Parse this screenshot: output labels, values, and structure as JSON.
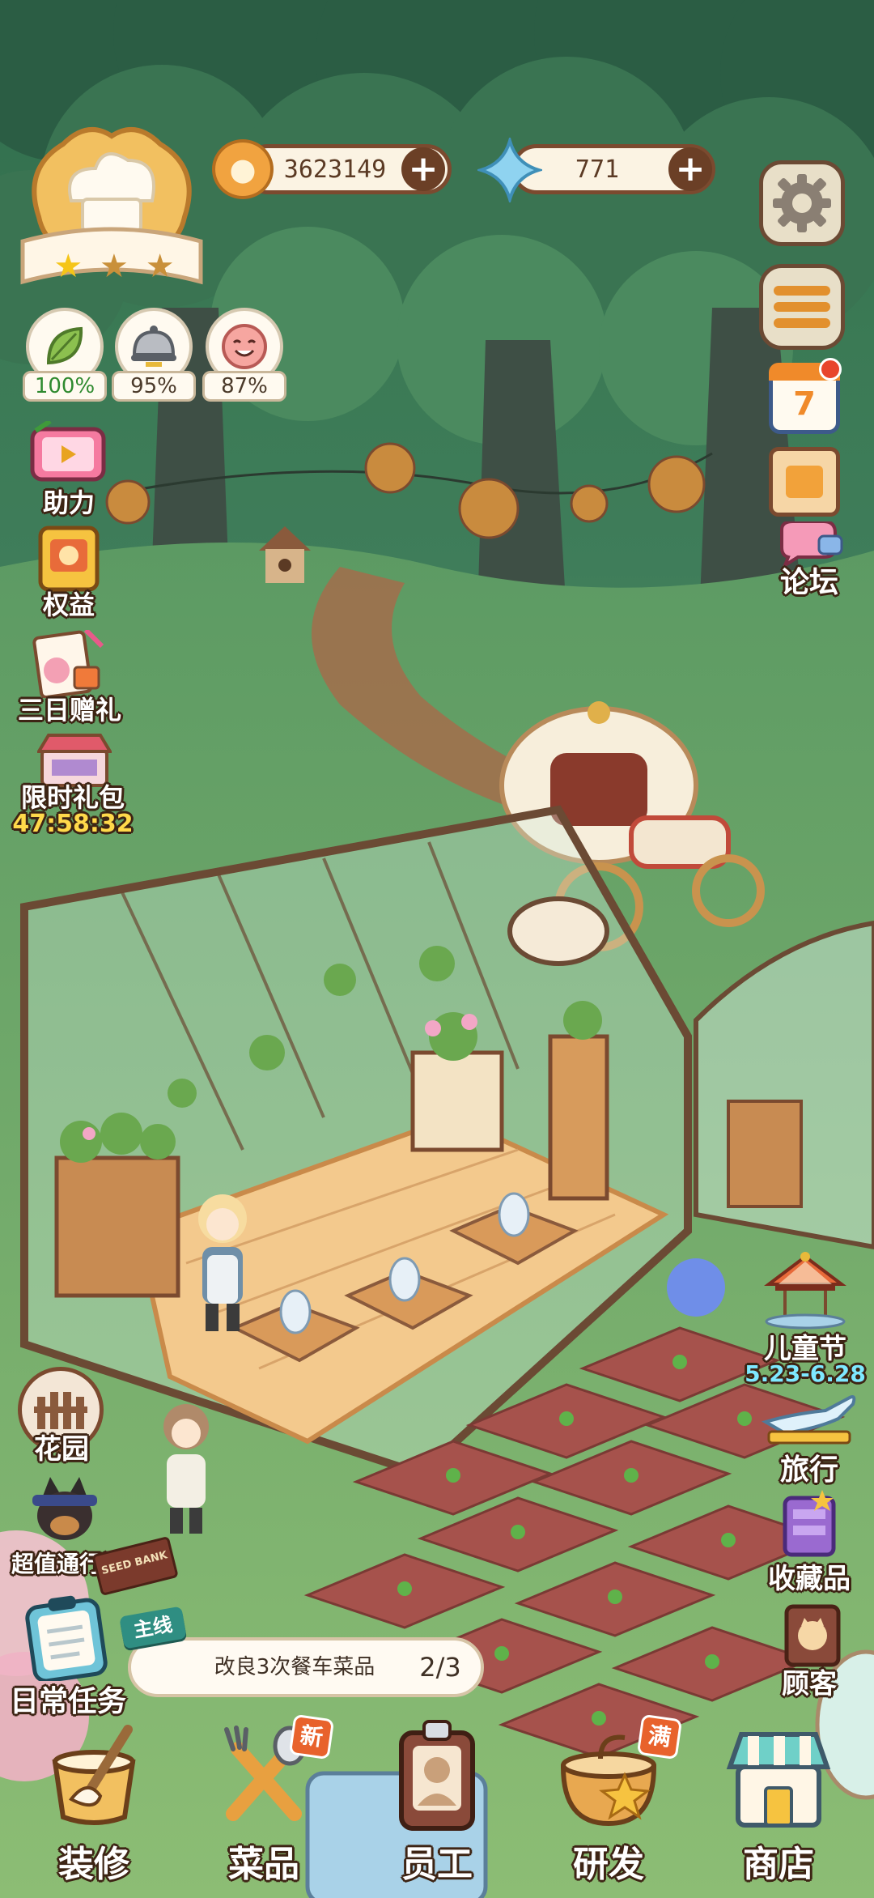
{
  "currency": {
    "coins": "3623149",
    "gems": "771"
  },
  "level": {
    "stars": 3
  },
  "stats": [
    {
      "icon": "leaf-icon",
      "value": "100%",
      "color": "#2f8a2f"
    },
    {
      "icon": "cloche-icon",
      "value": "95%",
      "color": "#4b3a2a"
    },
    {
      "icon": "smile-icon",
      "value": "87%",
      "color": "#4b3a2a"
    }
  ],
  "left_menu": {
    "support": "助力",
    "benefits": "权益",
    "three_day_gift": "三日赠礼",
    "limited_pack": "限时礼包",
    "limited_timer": "47:58:32",
    "garden": "花园",
    "battle_pass": "超值通行证"
  },
  "right_menu": {
    "calendar_day": "7",
    "forum": "论坛",
    "event_name": "儿童节",
    "event_dates": "5.23-6.28",
    "travel": "旅行",
    "collection": "收藏品",
    "customers": "顾客"
  },
  "quest": {
    "daily_label": "日常任务",
    "main_tag": "主线",
    "text": "改良3次餐车菜品",
    "progress": "2/3"
  },
  "bottom_nav": [
    {
      "label": "装修",
      "badge": ""
    },
    {
      "label": "菜品",
      "badge": "新"
    },
    {
      "label": "员工",
      "badge": ""
    },
    {
      "label": "研发",
      "badge": "满"
    },
    {
      "label": "商店",
      "badge": ""
    }
  ],
  "scene": {
    "seed_sign": "SEED BANK"
  },
  "colors": {
    "badge_red": "#e8622c",
    "timer_gold": "#ffd94a",
    "event_teal": "#7ee8ff"
  }
}
